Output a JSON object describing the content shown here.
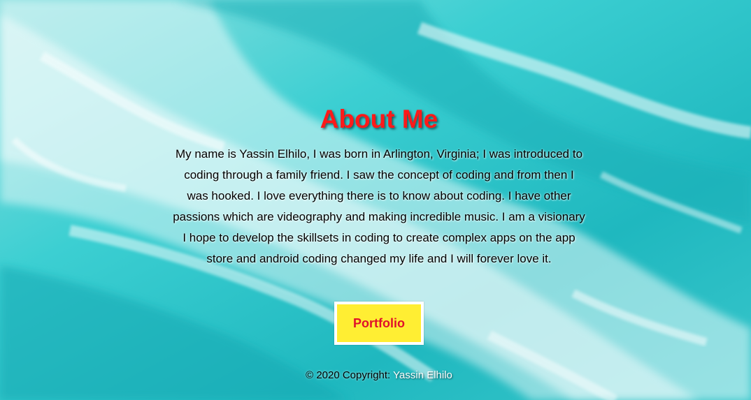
{
  "about": {
    "heading": "About Me",
    "bio": "My name is Yassin Elhilo, I was born in Arlington, Virginia; I was introduced to coding through a family friend. I saw the concept of coding and from then I was hooked. I love everything there is to know about coding. I have other passions which are videography and making incredible music. I am a visionary I hope to develop the skillsets in coding to create complex apps on the app store and android coding changed my life and I will forever love it."
  },
  "button": {
    "label": "Portfolio"
  },
  "footer": {
    "copyright": "© 2020 Copyright:",
    "author": "Yassin Elhilo"
  },
  "colors": {
    "heading": "#ff1a1a",
    "button_bg": "#ffee33",
    "button_text": "#e0102a",
    "ocean": "#2cc1c6"
  }
}
